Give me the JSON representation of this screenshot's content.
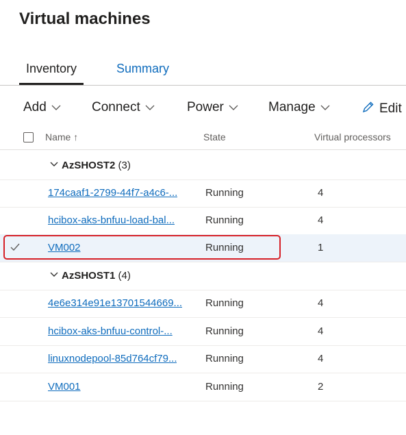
{
  "page": {
    "title": "Virtual machines"
  },
  "tabs": [
    {
      "label": "Inventory",
      "active": true
    },
    {
      "label": "Summary",
      "active": false
    }
  ],
  "toolbar": {
    "add_label": "Add",
    "connect_label": "Connect",
    "power_label": "Power",
    "manage_label": "Manage",
    "edit_label": "Edit"
  },
  "columns": {
    "name": "Name ↑",
    "state": "State",
    "virtual_processors": "Virtual processors"
  },
  "groups": [
    {
      "host": "AzSHOST2",
      "count": "(3)",
      "rows": [
        {
          "name": "174caaf1-2799-44f7-a4c6-...",
          "state": "Running",
          "vprocs": "4",
          "selected": false
        },
        {
          "name": "hcibox-aks-bnfuu-load-bal...",
          "state": "Running",
          "vprocs": "4",
          "selected": false
        },
        {
          "name": "VM002",
          "state": "Running",
          "vprocs": "1",
          "selected": true
        }
      ]
    },
    {
      "host": "AzSHOST1",
      "count": "(4)",
      "rows": [
        {
          "name": "4e6e314e91e13701544669...",
          "state": "Running",
          "vprocs": "4",
          "selected": false
        },
        {
          "name": "hcibox-aks-bnfuu-control-...",
          "state": "Running",
          "vprocs": "4",
          "selected": false
        },
        {
          "name": "linuxnodepool-85d764cf79...",
          "state": "Running",
          "vprocs": "4",
          "selected": false
        },
        {
          "name": "VM001",
          "state": "Running",
          "vprocs": "2",
          "selected": false
        }
      ]
    }
  ],
  "colors": {
    "link": "#0f6cbd",
    "selected_row": "#edf3fa",
    "highlight": "#d61f26"
  }
}
